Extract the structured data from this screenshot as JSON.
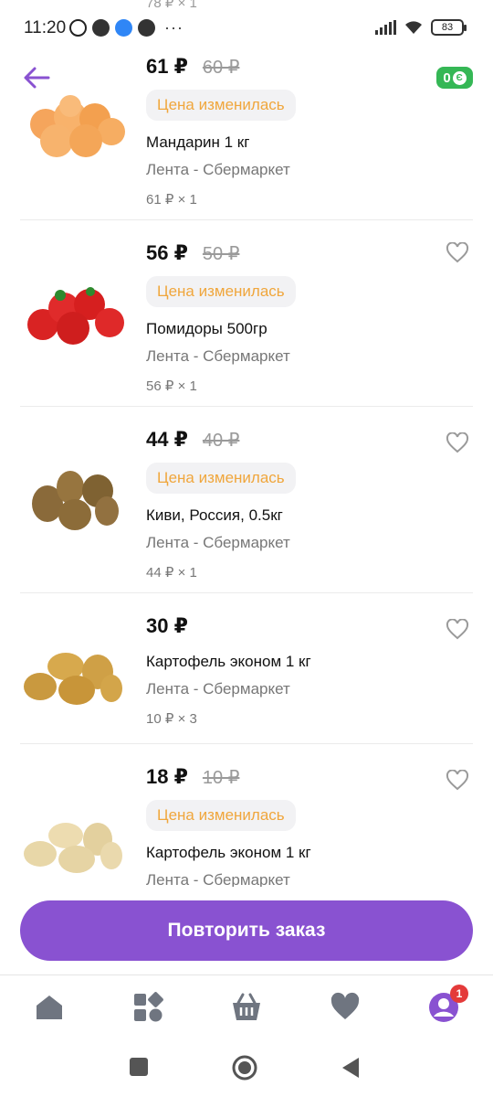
{
  "status_bar": {
    "time": "11:20",
    "battery": "83",
    "icons": [
      "alarm-icon",
      "app-icon",
      "messenger-icon",
      "app-icon",
      "more-icon",
      "signal-icon",
      "wifi-icon",
      "battery-icon"
    ]
  },
  "peek_text": "78 ₽ × 1",
  "header": {
    "back_icon": "arrow-left-icon",
    "balance_badge": "0"
  },
  "items": [
    {
      "price": "61 ₽",
      "old_price": "60 ₽",
      "chip": "Цена изменилась",
      "name": "Мандарин 1 кг",
      "store": "Лента - Сбермаркет",
      "qty": "61 ₽ × 1",
      "image": "mandarin-image"
    },
    {
      "price": "56 ₽",
      "old_price": "50 ₽",
      "chip": "Цена изменилась",
      "name": "Помидоры 500гр",
      "store": "Лента - Сбермаркет",
      "qty": "56 ₽ × 1",
      "image": "tomato-image"
    },
    {
      "price": "44 ₽",
      "old_price": "40 ₽",
      "chip": "Цена изменилась",
      "name": "Киви, Россия, 0.5кг",
      "store": "Лента - Сбермаркет",
      "qty": "44 ₽ × 1",
      "image": "kiwi-image"
    },
    {
      "price": "30 ₽",
      "old_price": "",
      "chip": "",
      "name": "Картофель эконом 1 кг",
      "store": "Лента - Сбермаркет",
      "qty": "10 ₽ × 3",
      "image": "potato-image"
    },
    {
      "price": "18 ₽",
      "old_price": "10 ₽",
      "chip": "Цена изменилась",
      "name": "Картофель эконом 1 кг",
      "store": "Лента - Сбермаркет",
      "qty": "",
      "image": "potato-image"
    }
  ],
  "repeat_button": "Повторить заказ",
  "bottom_nav": {
    "items": [
      "home-icon",
      "catalog-icon",
      "basket-icon",
      "favorites-icon",
      "profile-icon"
    ],
    "profile_badge": "1"
  },
  "colors": {
    "accent": "#8952d1",
    "chip_text": "#f0a63c",
    "badge_green": "#35b755",
    "badge_red": "#e43a3a"
  }
}
